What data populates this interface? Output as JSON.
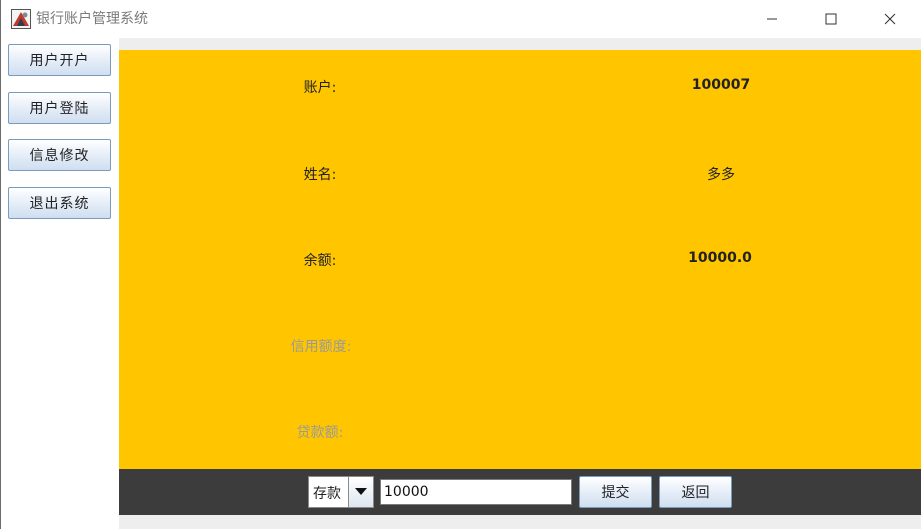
{
  "window": {
    "title": "银行账户管理系统"
  },
  "sidebar": {
    "items": [
      {
        "label": "用户开户"
      },
      {
        "label": "用户登陆"
      },
      {
        "label": "信息修改"
      },
      {
        "label": "退出系统"
      }
    ]
  },
  "info": {
    "account_label": "账户:",
    "account_value": "100007",
    "name_label": "姓名:",
    "name_value": "多多",
    "balance_label": "余额:",
    "balance_value": "10000.0",
    "credit_label": "信用额度:",
    "loan_label": "贷款额:"
  },
  "toolbar": {
    "operation_selected": "存款",
    "amount_value": "10000",
    "submit_label": "提交",
    "back_label": "返回"
  },
  "colors": {
    "panel_bg": "#ffc600",
    "toolbar_bg": "#3c3c3c",
    "disabled_label": "#9a9a9a"
  }
}
